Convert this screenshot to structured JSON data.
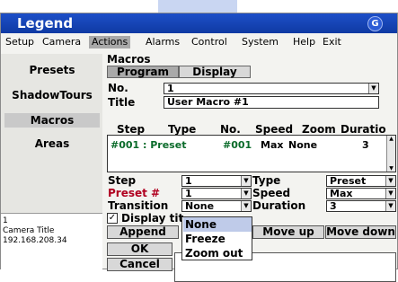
{
  "window": {
    "title": "Legend",
    "logo_glyph": "G"
  },
  "menu": [
    "Setup",
    "Camera",
    "Actions",
    "Alarms",
    "Control",
    "System",
    "Help",
    "Exit"
  ],
  "sidebar": {
    "items": [
      "Presets",
      "ShadowTours",
      "Macros",
      "Areas"
    ],
    "info": [
      "1",
      "Camera Title",
      "192.168.208.34"
    ]
  },
  "main": {
    "section": "Macros",
    "tabs": [
      "Program",
      "Display"
    ],
    "no_label": "No.",
    "no_value": "1",
    "title_label": "Title",
    "title_value": "User Macro #1",
    "columns": [
      "Step",
      "Type",
      "No.",
      "Speed",
      "Zoom",
      "Duratio"
    ],
    "row": {
      "step": "#001 : Preset",
      "no": "#001",
      "speed": "Max",
      "zoom": "None",
      "duration": "3"
    },
    "step_label": "Step",
    "step_value": "1",
    "preset_label": "Preset #",
    "preset_value": "1",
    "transition_label": "Transition",
    "transition_value": "None",
    "type_label": "Type",
    "type_value": "Preset",
    "speed_label": "Speed",
    "speed_value": "Max",
    "duration_label": "Duration",
    "duration_value": "3",
    "display_title_label": "Display tit",
    "buttons": {
      "append": "Append",
      "move_up": "Move up",
      "move_down": "Move down",
      "ok": "OK",
      "cancel": "Cancel"
    },
    "transition_options": [
      "None",
      "Freeze",
      "Zoom out"
    ]
  },
  "colors": {
    "titlebar": "#1d4fc8",
    "highlight": "#bfcbe9",
    "row_text": "#0a6b2a"
  }
}
